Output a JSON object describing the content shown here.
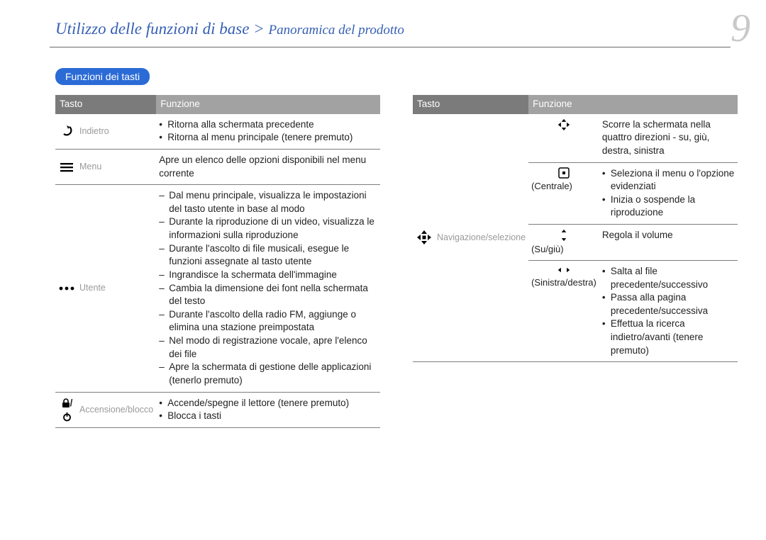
{
  "header": {
    "main": "Utilizzo delle funzioni di base",
    "sep": " > ",
    "sub": "Panoramica del prodotto"
  },
  "page_number": "9",
  "section_title": "Funzioni dei tasti",
  "table_headers": {
    "tasto": "Tasto",
    "funzione": "Funzione"
  },
  "left_rows": {
    "back": {
      "label": "Indietro",
      "items": [
        "Ritorna alla schermata precedente",
        "Ritorna al menu principale (tenere premuto)"
      ]
    },
    "menu": {
      "label": "Menu",
      "text": "Apre un elenco delle opzioni disponibili nel menu corrente"
    },
    "user": {
      "label": "Utente",
      "items": [
        "Dal menu principale, visualizza le impostazioni del tasto utente in base al modo",
        "Durante la riproduzione di un video, visualizza le informazioni sulla riproduzione",
        "Durante l'ascolto di file musicali, esegue le funzioni assegnate al tasto utente",
        "Ingrandisce la schermata dell'immagine",
        "Cambia la dimensione dei font nella schermata del testo",
        "Durante l'ascolto della radio FM, aggiunge o elimina una stazione preimpostata",
        "Nel modo di registrazione vocale, apre l'elenco dei file",
        "Apre la schermata di gestione delle applicazioni (tenerlo premuto)"
      ]
    },
    "power": {
      "label": "Accensione/blocco",
      "items": [
        "Accende/spegne il lettore (tenere premuto)",
        "Blocca i tasti"
      ]
    }
  },
  "right_group": {
    "label": "Navigazione/selezione",
    "dpad": {
      "text": "Scorre la schermata nella quattro direzioni - su, giù, destra, sinistra"
    },
    "center": {
      "label": "(Centrale)",
      "items": [
        "Seleziona il menu o l'opzione evidenziati",
        "Inizia o sospende la riproduzione"
      ]
    },
    "updown": {
      "label": "(Su/giù)",
      "text": "Regola il volume"
    },
    "leftright": {
      "label": "(Sinistra/destra)",
      "items": [
        "Salta al file precedente/successivo",
        "Passa alla pagina precedente/successiva",
        "Effettua la ricerca indietro/avanti (tenere premuto)"
      ]
    }
  }
}
